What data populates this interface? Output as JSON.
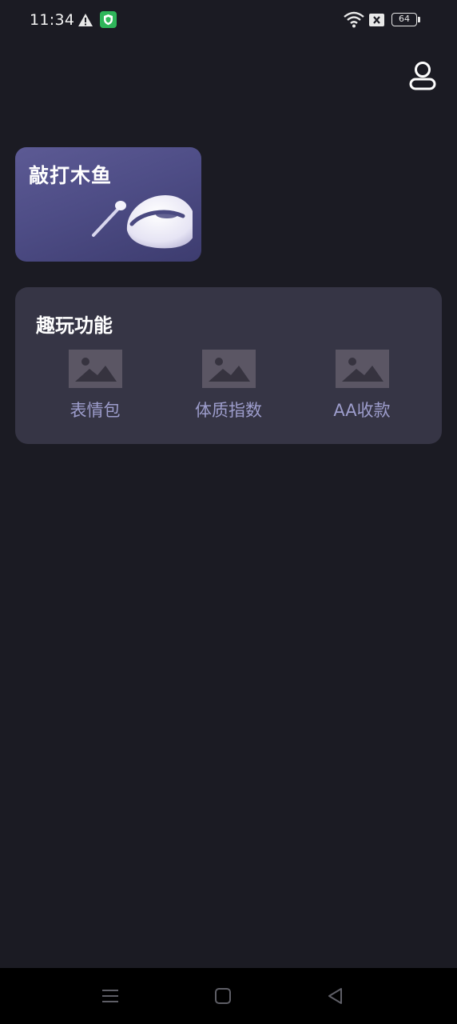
{
  "status_bar": {
    "time": "11:34",
    "battery": "64",
    "icons": [
      "warning-icon",
      "shield-icon",
      "wifi-icon",
      "no-sim-icon",
      "battery-icon"
    ]
  },
  "header": {
    "profile_icon": "user-icon"
  },
  "muyu_card": {
    "title": "敲打木鱼",
    "illustration": "wooden-fish-illustration",
    "gradient_colors": [
      "#5c5a94",
      "#3d3c6f"
    ]
  },
  "fun_features": {
    "title": "趣玩功能",
    "items": [
      {
        "label": "表情包",
        "icon": "image-placeholder-icon"
      },
      {
        "label": "体质指数",
        "icon": "image-placeholder-icon"
      },
      {
        "label": "AA收款",
        "icon": "image-placeholder-icon"
      }
    ]
  },
  "nav_bar": {
    "icons": [
      "menu-icon",
      "home-icon",
      "back-icon"
    ]
  },
  "colors": {
    "background": "#1b1b23",
    "panel": "#363545",
    "label_accent": "#9d9dcc",
    "shield_green": "#2fb65a"
  }
}
